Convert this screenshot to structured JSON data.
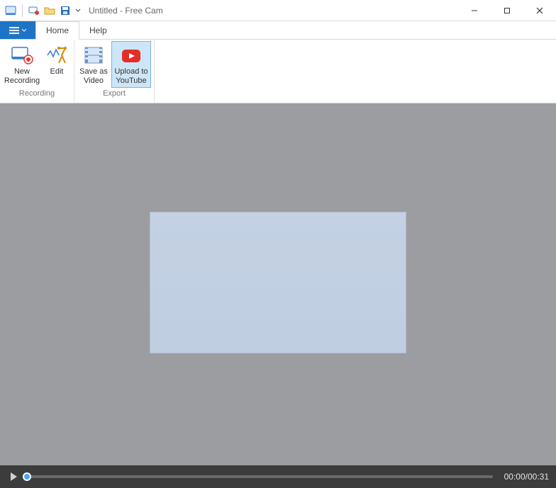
{
  "titlebar": {
    "title": "Untitled - Free Cam"
  },
  "tabs": {
    "home": "Home",
    "help": "Help"
  },
  "ribbon": {
    "recording": {
      "label": "Recording",
      "new_recording_l1": "New",
      "new_recording_l2": "Recording",
      "edit": "Edit"
    },
    "export": {
      "label": "Export",
      "save_as_video_l1": "Save as",
      "save_as_video_l2": "Video",
      "upload_youtube_l1": "Upload to",
      "upload_youtube_l2": "YouTube"
    }
  },
  "player": {
    "current": "00:00",
    "total": "00:31",
    "sep": "/"
  }
}
